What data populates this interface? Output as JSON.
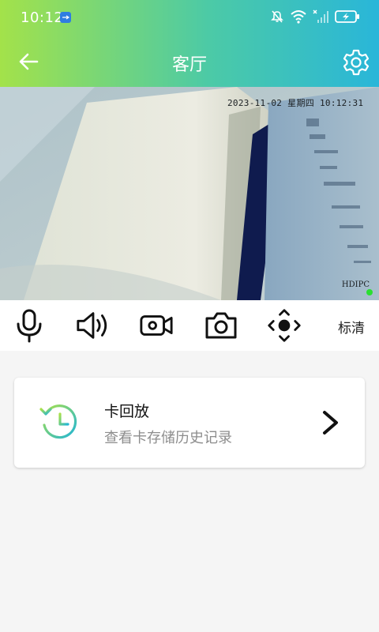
{
  "status_bar": {
    "time": "10:12"
  },
  "app_bar": {
    "title": "客厅",
    "back_icon": "arrow-left-icon",
    "settings_icon": "gear-icon"
  },
  "video": {
    "osd_timestamp": "2023-11-02  星期四  10:12:31",
    "osd_label": "HDIPC"
  },
  "toolbar": {
    "tools": [
      "microphone-icon",
      "speaker-icon",
      "video-record-icon",
      "camera-icon",
      "ptz-direction-icon"
    ],
    "quality_label": "标清"
  },
  "playback_card": {
    "title": "卡回放",
    "subtitle": "查看卡存储历史记录",
    "icon": "history-clock-icon",
    "chevron": "chevron-right-icon"
  },
  "colors": {
    "header_gradient_start": "#a3e24a",
    "header_gradient_end": "#29b6d9",
    "live_indicator": "#2adf31",
    "icon_teal": "#2cc3b8"
  }
}
